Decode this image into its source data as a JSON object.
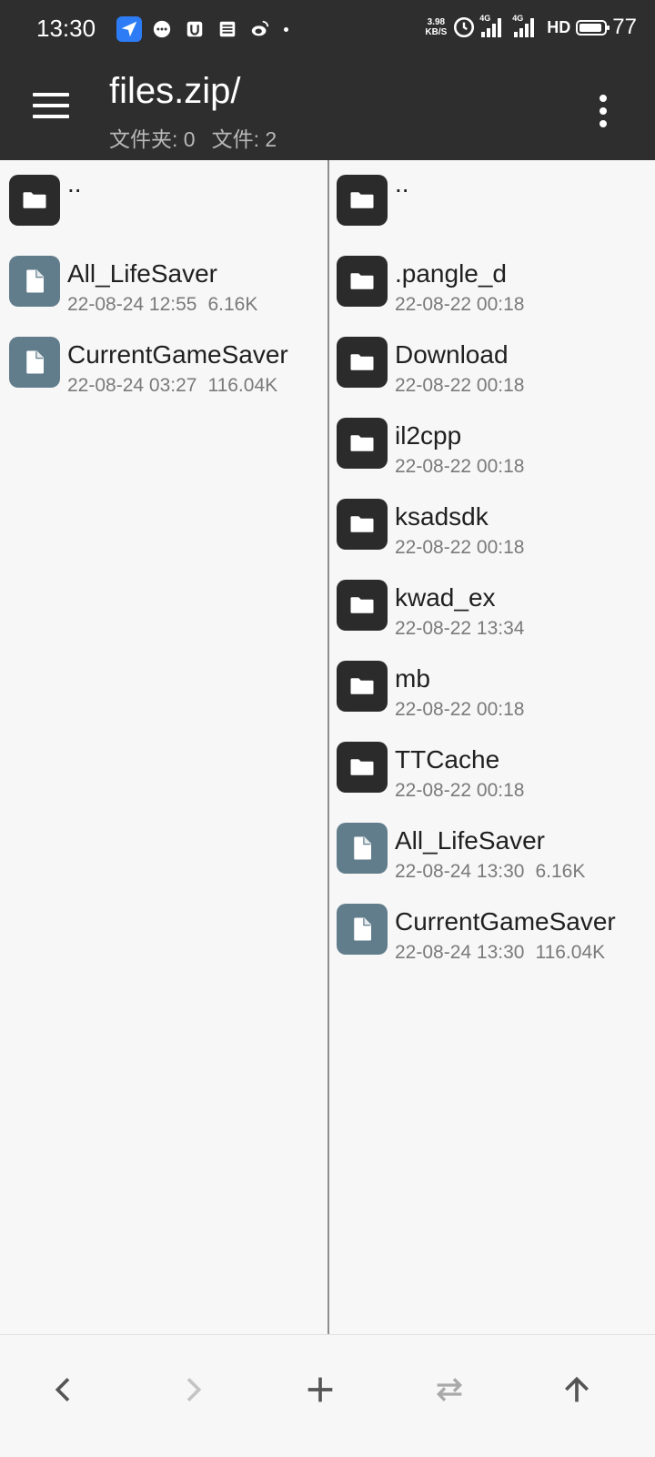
{
  "status_bar": {
    "time": "13:30",
    "net_speed_value": "3.98",
    "net_speed_unit": "KB/S",
    "net_type_1": "4G",
    "net_type_2": "4G",
    "hd": "HD",
    "battery": "77",
    "app_icons": [
      "navigation-icon",
      "chat-bubble-icon",
      "notification-u-icon",
      "list-icon",
      "weibo-icon"
    ]
  },
  "toolbar": {
    "title": "files.zip/",
    "folders_label": "文件夹: 0",
    "files_label": "文件: 2"
  },
  "left_pane": {
    "parent_label": "..",
    "items": [
      {
        "name": "All_LifeSaver",
        "date": "22-08-24 12:55",
        "size": "6.16K",
        "type": "file"
      },
      {
        "name": "CurrentGameSaver",
        "date": "22-08-24 03:27",
        "size": "116.04K",
        "type": "file"
      }
    ]
  },
  "right_pane": {
    "parent_label": "..",
    "items": [
      {
        "name": ".pangle_d",
        "date": "22-08-22 00:18",
        "size": "",
        "type": "folder"
      },
      {
        "name": "Download",
        "date": "22-08-22 00:18",
        "size": "",
        "type": "folder"
      },
      {
        "name": "il2cpp",
        "date": "22-08-22 00:18",
        "size": "",
        "type": "folder"
      },
      {
        "name": "ksadsdk",
        "date": "22-08-22 00:18",
        "size": "",
        "type": "folder"
      },
      {
        "name": "kwad_ex",
        "date": "22-08-22 13:34",
        "size": "",
        "type": "folder"
      },
      {
        "name": "mb",
        "date": "22-08-22 00:18",
        "size": "",
        "type": "folder"
      },
      {
        "name": "TTCache",
        "date": "22-08-22 00:18",
        "size": "",
        "type": "folder"
      },
      {
        "name": "All_LifeSaver",
        "date": "22-08-24 13:30",
        "size": "6.16K",
        "type": "file"
      },
      {
        "name": "CurrentGameSaver",
        "date": "22-08-24 13:30",
        "size": "116.04K",
        "type": "file"
      }
    ]
  },
  "bottom_bar": {
    "buttons": [
      "back-icon",
      "forward-icon",
      "add-icon",
      "swap-icon",
      "up-icon"
    ]
  }
}
